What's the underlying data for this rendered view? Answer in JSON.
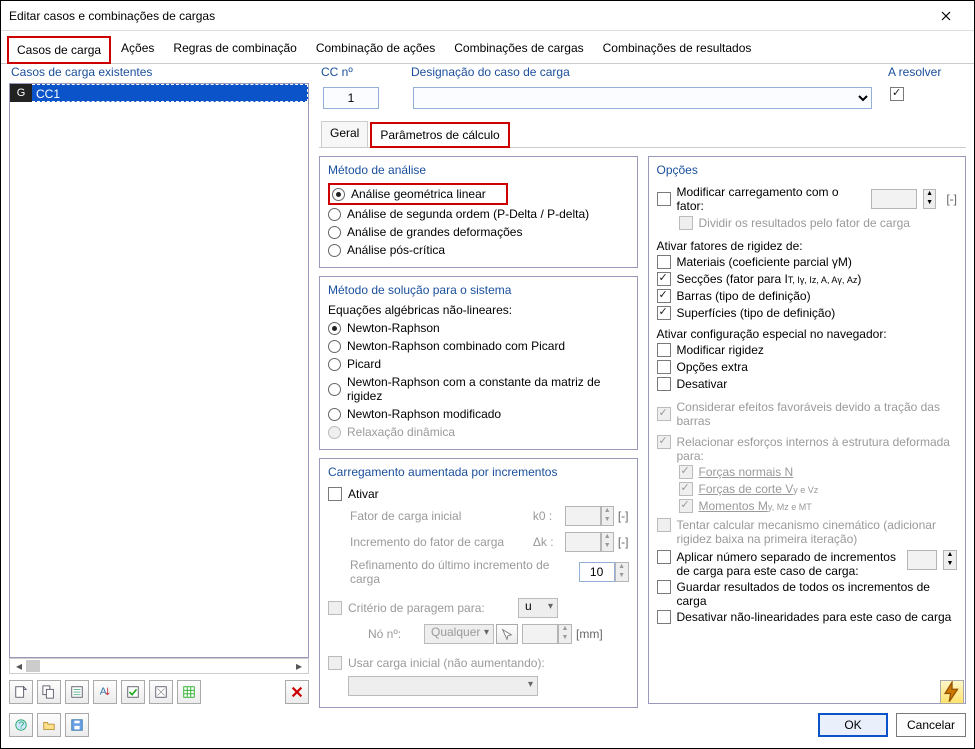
{
  "window": {
    "title": "Editar casos e combinações de cargas"
  },
  "mainTabs": {
    "t0": "Casos de carga",
    "t1": "Ações",
    "t2": "Regras de combinação",
    "t3": "Combinação de ações",
    "t4": "Combinações de cargas",
    "t5": "Combinações de resultados"
  },
  "left": {
    "header": "Casos de carga existentes",
    "rows": [
      {
        "badge": "G",
        "label": "CC1"
      }
    ]
  },
  "top": {
    "ccno_label": "CC nº",
    "ccno_value": "1",
    "design_label": "Designação do caso de carga",
    "resolve_label": "A resolver"
  },
  "subTabs": {
    "general": "Geral",
    "params": "Parâmetros de cálculo"
  },
  "panels": {
    "analysis": {
      "title": "Método de análise",
      "r0": "Análise geométrica linear",
      "r1": "Análise de segunda ordem (P-Delta / P-delta)",
      "r2": "Análise de grandes deformações",
      "r3": "Análise pós-crítica"
    },
    "solver": {
      "title": "Método de solução para o sistema",
      "intro": "Equações algébricas não-lineares:",
      "r0": "Newton-Raphson",
      "r1": "Newton-Raphson combinado com Picard",
      "r2": "Picard",
      "r3": "Newton-Raphson com a constante da matriz de rigidez",
      "r4": "Newton-Raphson modificado",
      "r5": "Relaxação dinâmica"
    },
    "incr": {
      "title": "Carregamento aumentada por incrementos",
      "activate": "Ativar",
      "k0": "Fator de carga inicial",
      "k0sym": "k0 :",
      "dk": "Incremento do fator de carga",
      "dksym": "Δk :",
      "refine": "Refinamento do último incremento de carga",
      "refine_val": "10",
      "crit": "Critério de paragem para:",
      "crit_val": "u",
      "no": "Nó nº:",
      "no_val": "Qualquer",
      "no_unit": "[mm]",
      "useinitial": "Usar carga inicial (não aumentando):"
    },
    "options": {
      "title": "Opções",
      "modfactor": "Modificar carregamento com o fator:",
      "modfactor_unit": "[-]",
      "divide": "Dividir os resultados pelo fator de carga",
      "rigidez_header": "Ativar fatores de rigidez de:",
      "rig0": "Materiais (coeficiente parcial γM)",
      "rig1_a": "Secções (fator para I",
      "rig1_b": ")",
      "rig1_subs": "T, Iγ, Iz, A, Aγ, Az",
      "rig2": "Barras (tipo de definição)",
      "rig3": "Superfícies (tipo de definição)",
      "spec_header": "Ativar configuração especial no navegador:",
      "sp0": "Modificar rigidez",
      "sp1": "Opções extra",
      "sp2": "Desativar",
      "fav": "Considerar efeitos favoráveis devido a tração das barras",
      "rel_header": "Relacionar esforços internos à estrutura deformada para:",
      "rel0": "Forças normais N",
      "rel1_a": "Forças de corte V",
      "rel1_sub": "y e Vz",
      "rel2_a": "Momentos M",
      "rel2_sub": "y, Mz e MT",
      "kin": "Tentar calcular mecanismo cinemático (adicionar rigidez baixa na primeira iteração)",
      "sep": "Aplicar número separado de incrementos de carga para este caso de carga:",
      "save": "Guardar resultados de todos os incrementos de carga",
      "disnl": "Desativar não-linearidades para este caso de carga"
    }
  },
  "buttons": {
    "ok": "OK",
    "cancel": "Cancelar"
  },
  "units": {
    "dash": "[-]"
  }
}
